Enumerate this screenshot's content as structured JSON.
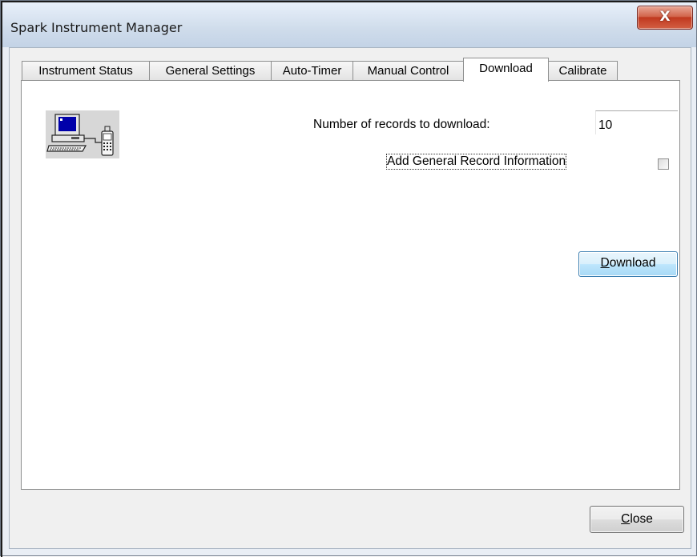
{
  "window": {
    "title": "Spark Instrument Manager",
    "close_glyph": "X"
  },
  "tabs": [
    {
      "label": "Instrument Status",
      "active": false
    },
    {
      "label": "General Settings",
      "active": false
    },
    {
      "label": "Auto-Timer",
      "active": false
    },
    {
      "label": "Manual Control",
      "active": false
    },
    {
      "label": "Download",
      "active": true
    },
    {
      "label": "Calibrate",
      "active": false
    }
  ],
  "download_panel": {
    "icon": "computer-and-handheld-device-icon",
    "records_label": "Number of records to download:",
    "records_value": "10",
    "general_info_label": "Add General Record Information",
    "general_info_checked": false,
    "download_button": {
      "mnemonic": "D",
      "rest": "ownload"
    }
  },
  "footer": {
    "close_button": {
      "mnemonic": "C",
      "rest": "lose"
    }
  }
}
